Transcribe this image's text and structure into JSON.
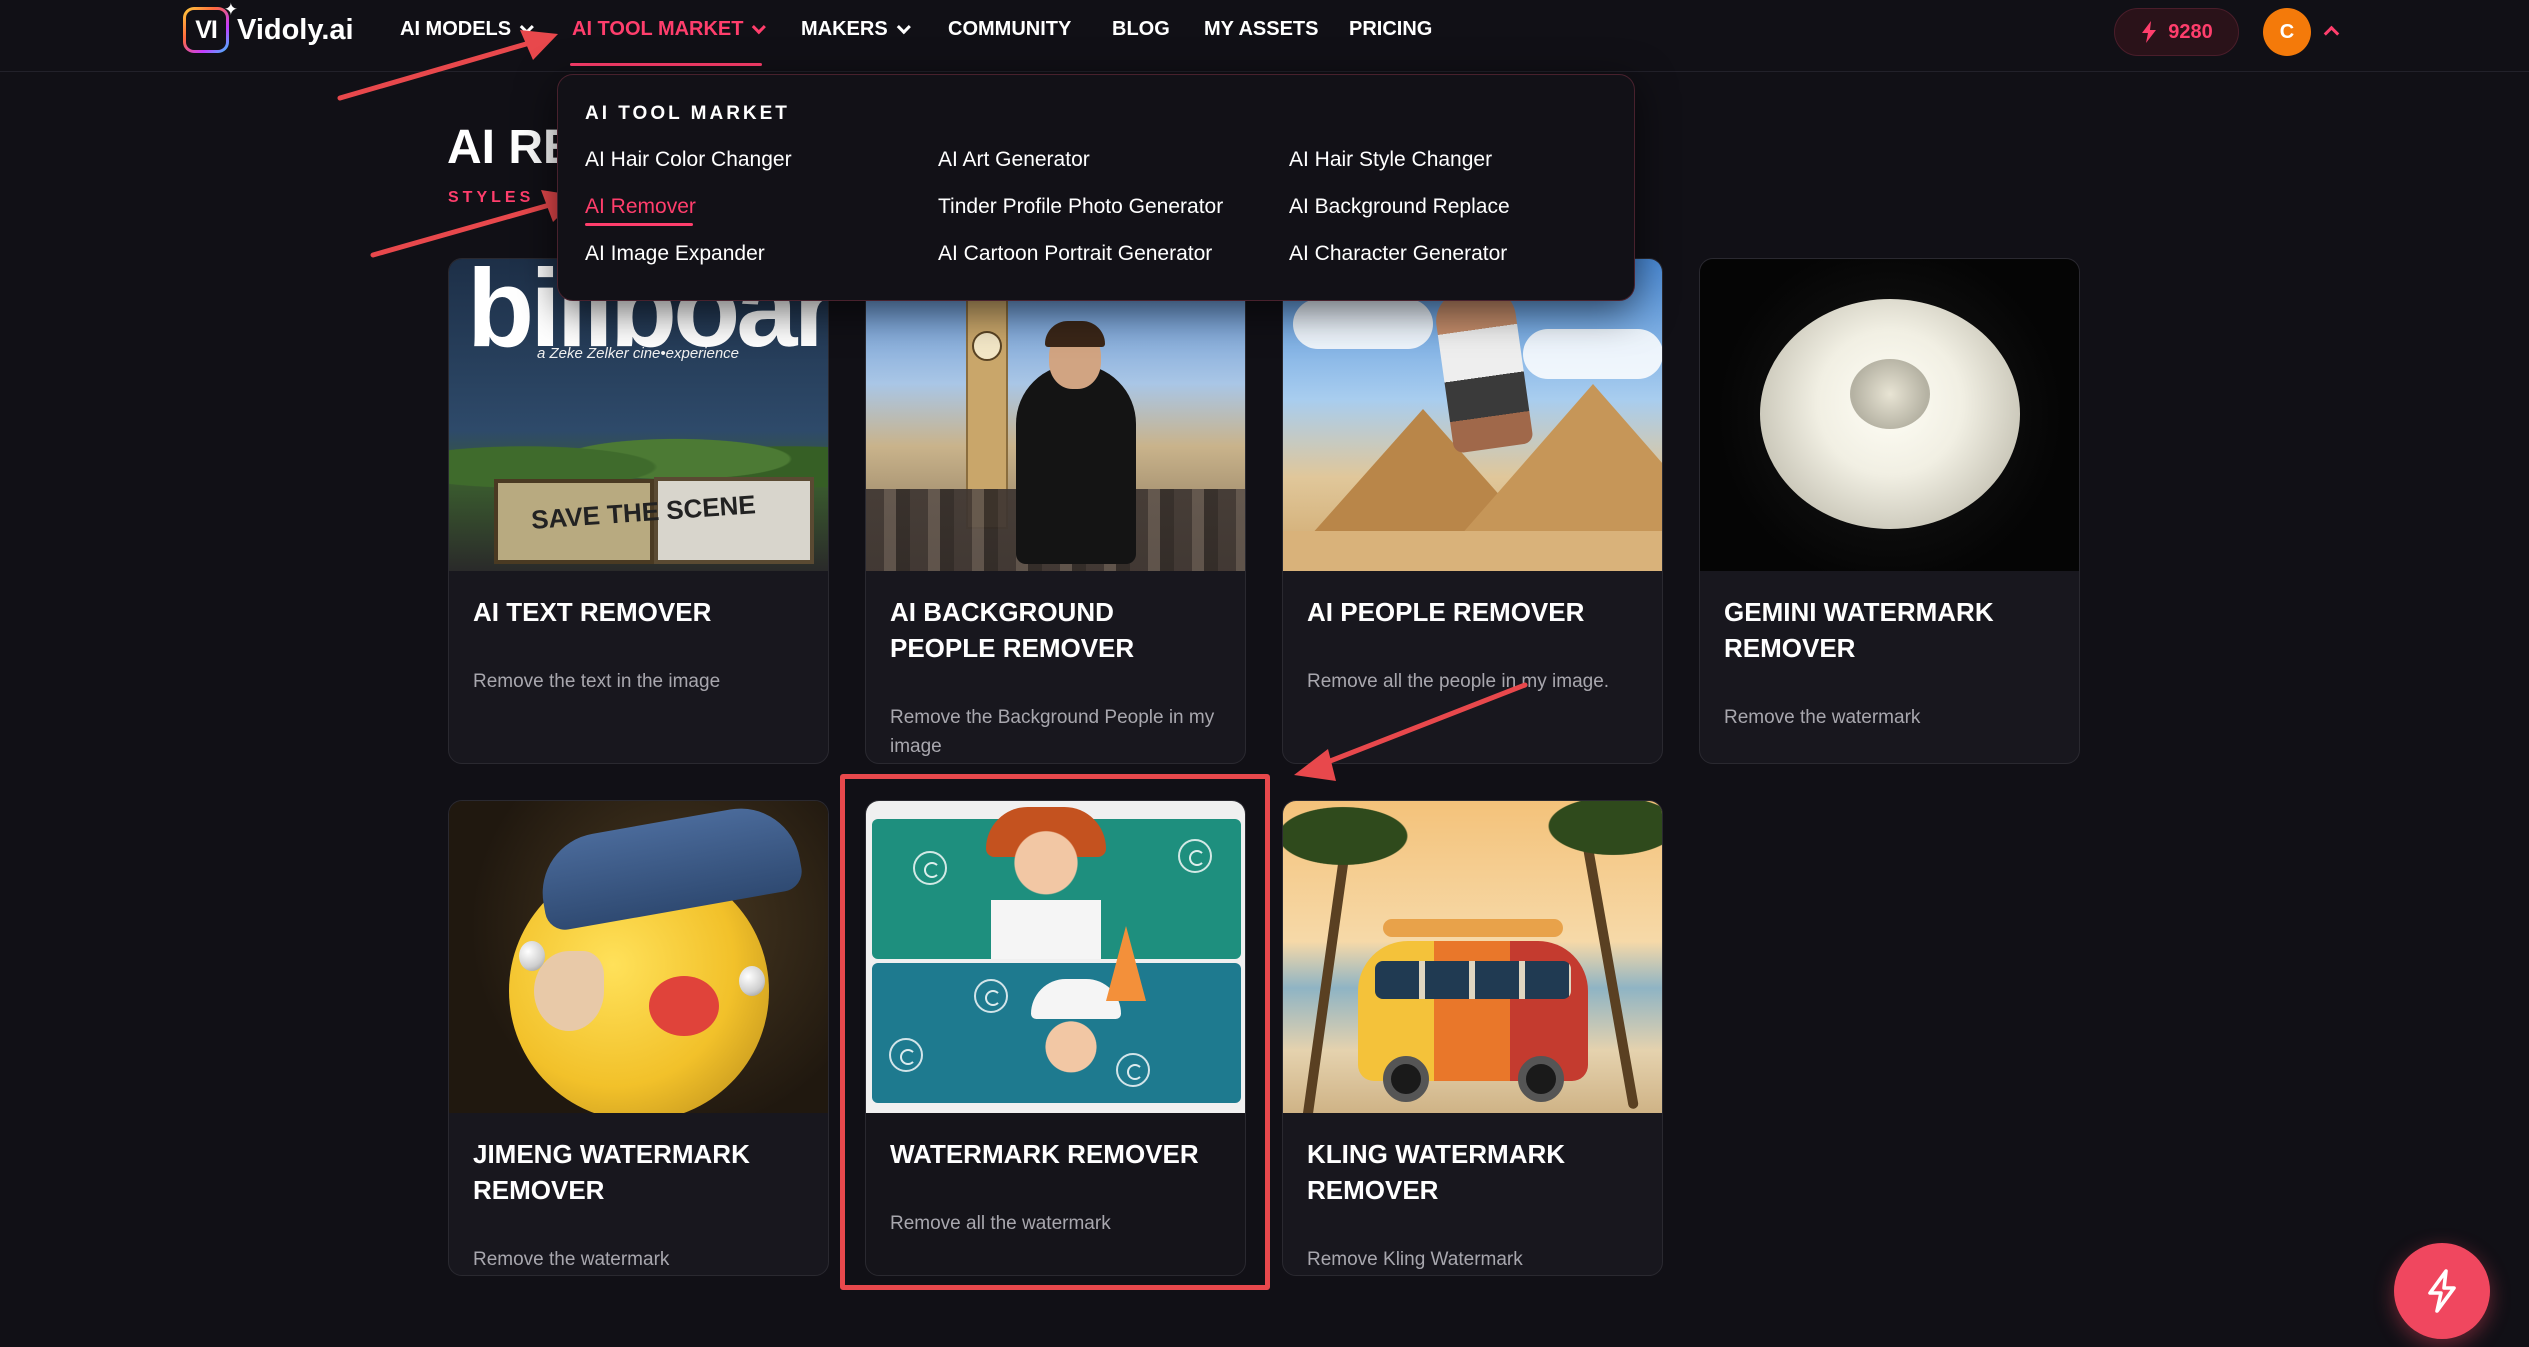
{
  "brand": {
    "name": "Vidoly.ai",
    "badge": "VI"
  },
  "nav": {
    "items": [
      {
        "label": "AI MODELS",
        "has_dropdown": true,
        "active": false
      },
      {
        "label": "AI TOOL MARKET",
        "has_dropdown": true,
        "active": true
      },
      {
        "label": "MAKERS",
        "has_dropdown": true,
        "active": false
      },
      {
        "label": "COMMUNITY",
        "has_dropdown": false,
        "active": false
      },
      {
        "label": "BLOG",
        "has_dropdown": false,
        "active": false
      },
      {
        "label": "MY ASSETS",
        "has_dropdown": false,
        "active": false
      },
      {
        "label": "PRICING",
        "has_dropdown": false,
        "active": false
      }
    ],
    "credits": "9280",
    "avatar_initial": "C"
  },
  "page": {
    "title_visible": "AI RE",
    "subtitle_visible": "STYLES"
  },
  "dropdown": {
    "heading": "AI TOOL MARKET",
    "columns": [
      [
        "AI Hair Color Changer",
        "AI Remover",
        "AI Image Expander"
      ],
      [
        "AI Art Generator",
        "Tinder Profile Photo Generator",
        "AI Cartoon Portrait Generator"
      ],
      [
        "AI Hair Style Changer",
        "AI Background Replace",
        "AI Character Generator"
      ]
    ],
    "active_item": "AI Remover"
  },
  "cards": [
    {
      "title": "AI TEXT REMOVER",
      "desc": "Remove the text in the image",
      "art_text": "billboard",
      "art_sub": "a Zeke Zelker cine•experience",
      "art_sign": "SAVE THE SCENE"
    },
    {
      "title": "AI BACKGROUND PEOPLE REMOVER",
      "desc": "Remove the Background People in my image"
    },
    {
      "title": "AI PEOPLE REMOVER",
      "desc": "Remove all the people in my image."
    },
    {
      "title": "GEMINI WATERMARK REMOVER",
      "desc": "Remove the watermark"
    },
    {
      "title": "JIMENG WATERMARK REMOVER",
      "desc": "Remove the watermark"
    },
    {
      "title": "WATERMARK REMOVER",
      "desc": "Remove all the watermark",
      "highlighted": true
    },
    {
      "title": "KLING WATERMARK REMOVER",
      "desc": "Remove Kling Watermark"
    }
  ],
  "colors": {
    "accent": "#ff3e6c",
    "background": "#111016",
    "card": "#18171e",
    "annotation": "#e8484c",
    "avatar": "#f47a0a"
  },
  "icons": {
    "credits": "lightning-icon",
    "fab": "lightning-icon",
    "nav_dropdown": "chevron-down-icon",
    "account_menu": "chevron-up-icon"
  }
}
